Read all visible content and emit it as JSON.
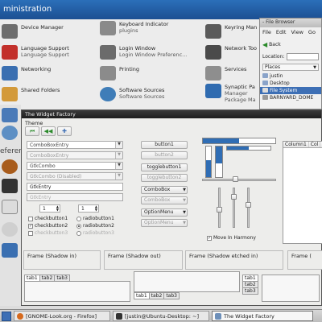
{
  "admin_window": {
    "title": "ministration",
    "items": [
      {
        "label": "Device Manager",
        "sub": "",
        "color": "#6d6d6d"
      },
      {
        "label": "Keyboard Indicator",
        "sub": "plugins",
        "color": "#8a8a8a"
      },
      {
        "label": "Keyring Man",
        "sub": "",
        "color": "#5a5a5a"
      },
      {
        "label": "Language Support",
        "sub": "Language Support",
        "color": "#c2302b"
      },
      {
        "label": "Login Window",
        "sub": "Login Window Preferenc...",
        "color": "#6b6b6b"
      },
      {
        "label": "Network Too",
        "sub": "",
        "color": "#4a4a4a"
      },
      {
        "label": "Networking",
        "sub": "",
        "color": "#3a6fb1"
      },
      {
        "label": "Printing",
        "sub": "",
        "color": "#8b8b8b"
      },
      {
        "label": "Services",
        "sub": "",
        "color": "#8e8e8e"
      },
      {
        "label": "Shared Folders",
        "sub": "",
        "color": "#d39a3a"
      },
      {
        "label": "Software Sources",
        "sub": "Software Sources",
        "color": "#3f7db8"
      },
      {
        "label": "Synaptic Pa",
        "sub": "Manager\nPackage Ma",
        "color": "#2f6bb0"
      }
    ],
    "side_label": "eferen"
  },
  "file_browser": {
    "title": "- File Browser",
    "menu": [
      "File",
      "Edit",
      "View",
      "Go"
    ],
    "back_label": "Back",
    "location_label": "Location:",
    "places_label": "Places",
    "entries": [
      {
        "name": "justin",
        "selected": false
      },
      {
        "name": "Desktop",
        "selected": false
      },
      {
        "name": "File System",
        "selected": true
      },
      {
        "name": "BARNYARD_DOME",
        "selected": false
      }
    ]
  },
  "widget_factory": {
    "title": "The Widget Factory",
    "menu": "Theme",
    "combos": {
      "c1": "ComboBoxEntry",
      "c2": "ComboBoxEntry",
      "c3": "GtkCombo",
      "c4": "GtkCombo (Disabled)"
    },
    "entries": {
      "e1": "GtkEntry",
      "e2": "GtkEntry"
    },
    "spin1": "1",
    "spin2": "1",
    "checks": {
      "cb1": "checkbutton1",
      "rb1": "radiobutton1",
      "cb2": "checkbutton2",
      "rb2": "radiobutton2",
      "cb3": "checkbutton3",
      "rb3": "radiobutton3"
    },
    "buttons": {
      "b1": "button1",
      "b2": "button2",
      "t1": "togglebutton1",
      "t2": "togglebutton2",
      "cmb1": "ComboBox",
      "cmb2": "ComboBox",
      "opt1": "OptionMenu",
      "opt2": "OptionMenu"
    },
    "move_label": "Move In Harmony",
    "tree_columns": [
      "Column1",
      "Col"
    ],
    "frames": {
      "f1": "Frame (Shadow in)",
      "f2": "Frame (Shadow out)",
      "f3": "Frame (Shadow etched in)",
      "f4": "Frame ("
    },
    "tabs": [
      "tab1",
      "tab2",
      "tab3"
    ],
    "progress": {
      "top": 0.5,
      "side": 0.5,
      "vertical": 0.55
    },
    "colors": {
      "accent": "#2f6db4"
    }
  },
  "taskbar": {
    "tasks": [
      {
        "label": "[GNOME-Look.org - Firefox]",
        "active": false
      },
      {
        "label": "[justin@Ubuntu-Desktop: ~]",
        "active": false
      },
      {
        "label": "The Widget Factory",
        "active": true
      }
    ]
  }
}
